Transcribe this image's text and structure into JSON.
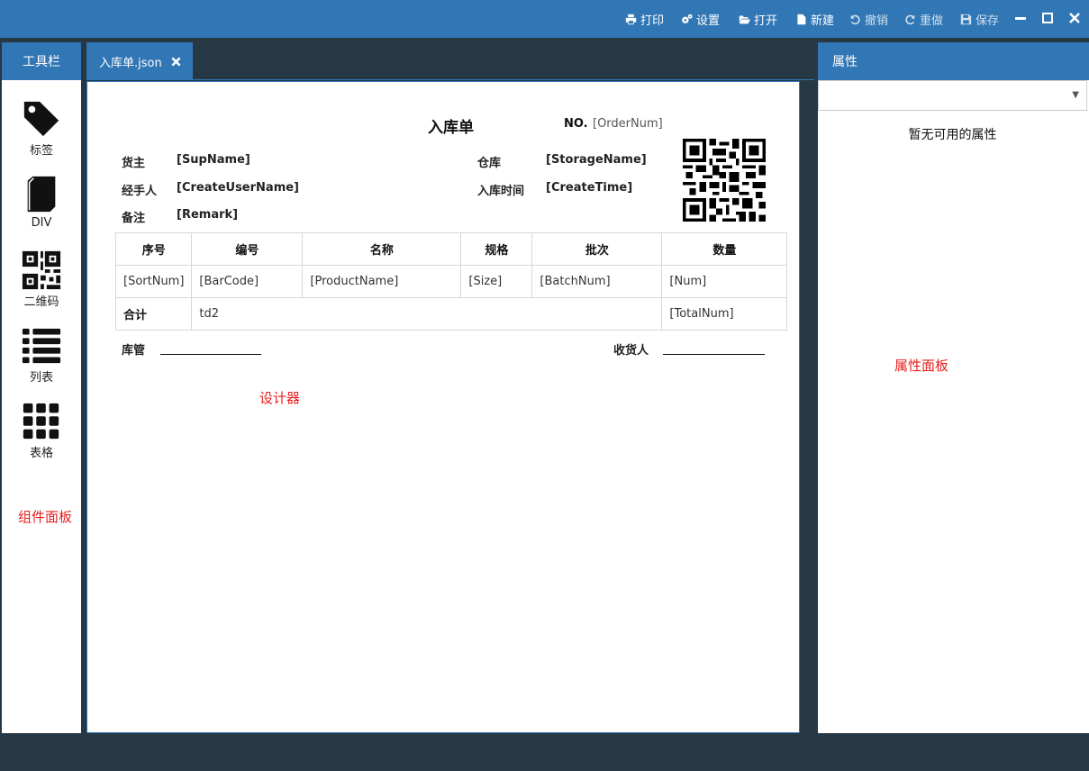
{
  "toolbar": {
    "print": "打印",
    "settings": "设置",
    "open": "打开",
    "new": "新建",
    "undo": "撤销",
    "redo": "重做",
    "save": "保存"
  },
  "left_panel": {
    "title": "工具栏",
    "components": [
      {
        "label": "标签",
        "icon": "tag-icon"
      },
      {
        "label": "DIV",
        "icon": "book-icon"
      },
      {
        "label": "二维码",
        "icon": "qrcode-icon"
      },
      {
        "label": "列表",
        "icon": "list-icon"
      },
      {
        "label": "表格",
        "icon": "grid-icon"
      }
    ],
    "note": "组件面板"
  },
  "tab": {
    "label": "入库单.json"
  },
  "designer": {
    "note": "设计器",
    "title": "入库单",
    "no_label": "NO.",
    "no_value": "[OrderNum]",
    "fields": {
      "owner_label": "货主",
      "owner_value": "[SupName]",
      "warehouse_label": "仓库",
      "warehouse_value": "[StorageName]",
      "handler_label": "经手人",
      "handler_value": "[CreateUserName]",
      "time_label": "入库时间",
      "time_value": "[CreateTime]",
      "remark_label": "备注",
      "remark_value": "[Remark]"
    },
    "table": {
      "headers": [
        "序号",
        "编号",
        "名称",
        "规格",
        "批次",
        "数量"
      ],
      "row": [
        "[SortNum]",
        "[BarCode]",
        "[ProductName]",
        "[Size]",
        "[BatchNum]",
        "[Num]"
      ],
      "total_label": "合计",
      "total_mid": "td2",
      "total_value": "[TotalNum]"
    },
    "sign": {
      "keeper": "库管",
      "receiver": "收货人"
    }
  },
  "right_panel": {
    "title": "属性",
    "empty": "暂无可用的属性",
    "note": "属性面板"
  }
}
